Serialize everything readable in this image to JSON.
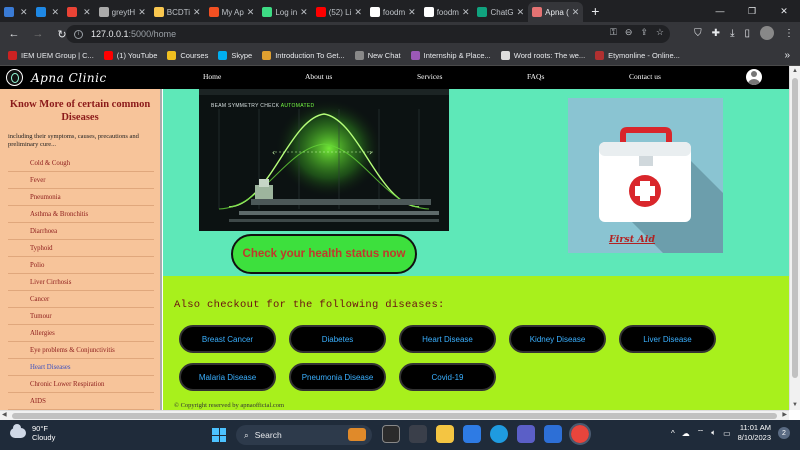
{
  "browser": {
    "tabs": [
      {
        "title": "",
        "color": "#3a7bd5",
        "active": false
      },
      {
        "title": "",
        "color": "#1e88e5",
        "active": false
      },
      {
        "title": "",
        "color": "#ea4335",
        "active": false
      },
      {
        "title": "greytH",
        "color": "#aaaaaa",
        "active": false
      },
      {
        "title": "BCDTi",
        "color": "#f9c74f",
        "active": false
      },
      {
        "title": "My Ap",
        "color": "#f25022",
        "active": false
      },
      {
        "title": "Log in",
        "color": "#3ddc84",
        "active": false
      },
      {
        "title": "(52) Li",
        "color": "#ff0000",
        "active": false
      },
      {
        "title": "foodm",
        "color": "#ffffff",
        "active": false
      },
      {
        "title": "foodm",
        "color": "#ffffff",
        "active": false
      },
      {
        "title": "ChatG",
        "color": "#10a37f",
        "active": false
      },
      {
        "title": "Apna (",
        "color": "#e57373",
        "active": true
      }
    ],
    "new_tab": "+",
    "window_controls": {
      "minimize": "—",
      "maximize": "❐",
      "close": "✕"
    },
    "back": "←",
    "forward": "→",
    "reload": "↻",
    "url_host": "127.0.0.1",
    "url_path": ":5000/home",
    "bookmarks": [
      {
        "label": "IEM UEM Group | C...",
        "color": "#cc2222"
      },
      {
        "label": "(1) YouTube",
        "color": "#ff0000"
      },
      {
        "label": "Courses",
        "color": "#f0c020"
      },
      {
        "label": "Skype",
        "color": "#00aff0"
      },
      {
        "label": "Introduction To Get...",
        "color": "#e0a030"
      },
      {
        "label": "New Chat",
        "color": "#888888"
      },
      {
        "label": "Internship & Place...",
        "color": "#9b59b6"
      },
      {
        "label": "Word roots: The we...",
        "color": "#dddddd"
      },
      {
        "label": "Etymonline - Online...",
        "color": "#b03030"
      }
    ],
    "bookmarks_more": "»"
  },
  "site": {
    "brand": "Apna Clinic",
    "nav": [
      "Home",
      "About us",
      "Services",
      "FAQs",
      "Contact us"
    ],
    "sidebar": {
      "title": "Know More of certain common Diseases",
      "description": "including their symptoms, causes, precautions and preliminary cure...",
      "items": [
        "Cold & Cough",
        "Fever",
        "Pneumonia",
        "Asthma & Bronchitis",
        "Diarrhoea",
        "Typhoid",
        "Polio",
        "Liver Cirrhosis",
        "Cancer",
        "Tumour",
        "Allergies",
        "Eye problems & Conjunctivitis",
        "Heart Diseases",
        "Chronic Lower Respiration",
        "AIDS"
      ],
      "active_item": "Heart Diseases"
    },
    "hero": {
      "video_caption": "BEAM SYMMETRY CHECK",
      "video_caption_tag": "AUTOMATED",
      "check_button": "Check your health status now",
      "first_aid": "First Aid"
    },
    "diseases_heading": "Also checkout for the following diseases:",
    "diseases": [
      "Breast Cancer",
      "Diabetes",
      "Heart Disease",
      "Kidney Disease",
      "Liver Disease",
      "Malaria Disease",
      "Pneumonia Disease",
      "Covid-19"
    ],
    "copyright": "© Copyright reserved by apnaofficial.com"
  },
  "taskbar": {
    "weather_temp": "90°F",
    "weather_desc": "Cloudy",
    "search_placeholder": "Search",
    "time": "11:01 AM",
    "date": "8/10/2023",
    "notifications": "2",
    "tray_expand": "^"
  },
  "colors": {
    "hero_bg": "#5ee8b8",
    "lower_bg": "#a8f01c",
    "sidebar_bg": "#f7c49a",
    "check_btn": "#3de03d",
    "disease_btn_text": "#3ab0ff"
  }
}
